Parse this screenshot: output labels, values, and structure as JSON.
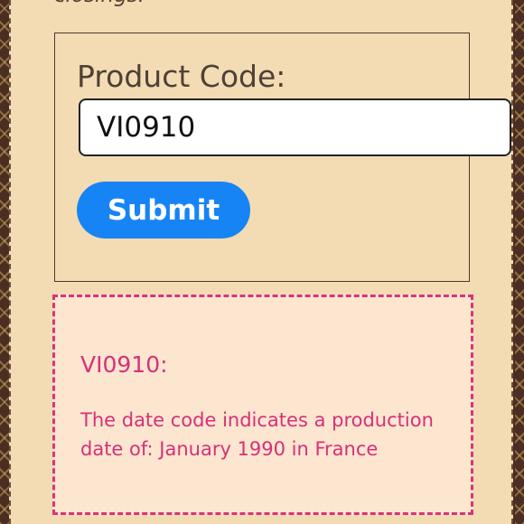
{
  "intro": {
    "text": "closings."
  },
  "form": {
    "label": "Product Code:",
    "input_value": "VI0910",
    "submit_label": "Submit"
  },
  "result": {
    "code": "VI0910:",
    "message": "The date code indicates a production date of: January 1990 in France"
  },
  "colors": {
    "page_background": "#f3dcb3",
    "result_background": "#fde6cf",
    "result_accent": "#d6307a",
    "button": "#1784f5",
    "monogram_border": "#4a2e22"
  }
}
